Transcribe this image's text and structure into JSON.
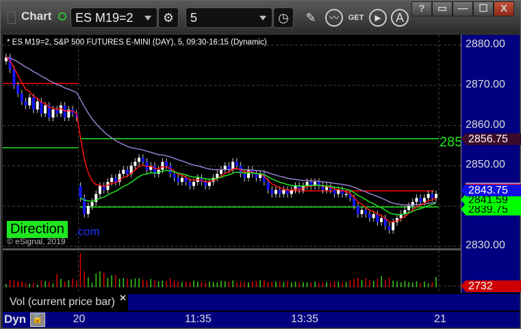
{
  "window": {
    "title": "Chart",
    "buttons": [
      "?",
      "▭",
      "—",
      "☐",
      "X"
    ]
  },
  "toolbar": {
    "symbol": "ES M19=2",
    "interval": "5"
  },
  "chart": {
    "info": "* ES M19=2, S&P 500 FUTURES E-MINI (DAY), 5, 09:30-16:15 (Dynamic)",
    "direction_label": "Direction",
    "link_fragment": ".com",
    "copyright": "© eSignal, 2019",
    "line_label": "285",
    "tags": [
      {
        "text": "2856.75",
        "bg": "#3c0a2a",
        "fg": "#ffffff"
      },
      {
        "text": "2843.75",
        "bg": "#1010e0",
        "fg": "#ffffff"
      },
      {
        "text": "2841.59",
        "bg": "#00ff00",
        "fg": "#000000"
      },
      {
        "text": "2839.75",
        "bg": "#00ff00",
        "fg": "#000000"
      }
    ],
    "volume_tag": "2732",
    "volume_study": "Vol (current price bar)",
    "close_symbol": "✕",
    "dyn": "Dyn"
  },
  "chart_data": {
    "type": "candlestick",
    "ylim": [
      2830,
      2880
    ],
    "yticks": [
      "2880.00",
      "2870.00",
      "2860.00",
      "2850.00",
      "2830.00"
    ],
    "xticks": [
      "20",
      "11:35",
      "13:35",
      "21"
    ],
    "closes": [
      2877,
      2874,
      2870,
      2868,
      2866,
      2865,
      2867,
      2864,
      2866,
      2863,
      2865,
      2862,
      2864,
      2863,
      2865,
      2862,
      2864,
      2863,
      2862,
      2842,
      2838,
      2840,
      2841,
      2843,
      2845,
      2844,
      2846,
      2847,
      2846,
      2848,
      2849,
      2848,
      2850,
      2851,
      2852,
      2851,
      2849,
      2850,
      2848,
      2849,
      2851,
      2850,
      2848,
      2847,
      2846,
      2847,
      2846,
      2845,
      2846,
      2847,
      2846,
      2845,
      2846,
      2847,
      2848,
      2849,
      2850,
      2849,
      2851,
      2850,
      2848,
      2847,
      2849,
      2848,
      2847,
      2848,
      2846,
      2844,
      2843,
      2844,
      2843,
      2844,
      2843,
      2844,
      2845,
      2844,
      2845,
      2846,
      2845,
      2846,
      2845,
      2844,
      2845,
      2844,
      2843,
      2844,
      2843,
      2843,
      2842,
      2840,
      2838,
      2839,
      2838,
      2837,
      2838,
      2836,
      2837,
      2835,
      2834,
      2836,
      2837,
      2838,
      2839,
      2840,
      2841,
      2842,
      2841,
      2842,
      2843,
      2842,
      2843
    ],
    "volume": [
      900,
      2000,
      1800,
      1600,
      1500,
      1100,
      900,
      1200,
      700,
      1800,
      1600,
      1500,
      1000,
      3500,
      2200,
      1500,
      1900,
      2300,
      1700,
      9000,
      4200,
      2600,
      1200,
      3600,
      4200,
      3800,
      2500,
      3200,
      3200,
      2200,
      2400,
      2300,
      2100,
      2300,
      2400,
      2000,
      1800,
      2200,
      1900,
      1600,
      1800,
      1700,
      2400,
      1700,
      1500,
      1300,
      1600,
      1400,
      1800,
      1500,
      1300,
      1200,
      1500,
      1400,
      1300,
      1700,
      1600,
      1500,
      1800,
      1200,
      1500,
      1400,
      1300,
      1600,
      1700,
      1900,
      2100,
      1300,
      1400,
      1500,
      1600,
      1400,
      1700,
      1300,
      1500,
      1200,
      1400,
      1300,
      1200,
      1500,
      1100,
      1300,
      1400,
      1200,
      1600,
      1500,
      1300,
      1400,
      1800,
      2200,
      2600,
      1900,
      2400,
      2000,
      1700,
      2200,
      2900,
      1900,
      2500,
      1800,
      1500,
      1300,
      1700,
      1400,
      1200,
      1600,
      1100,
      1500,
      1000,
      1300,
      2732
    ],
    "levels": [
      {
        "price": 2870.5,
        "color": "#ff0000",
        "day": 1
      },
      {
        "price": 2854.5,
        "color": "#1fe81f",
        "day": 1
      },
      {
        "price": 2856.75,
        "color": "#1fe81f",
        "day": 2
      },
      {
        "price": 2839.75,
        "color": "#1fe81f",
        "day": 2
      },
      {
        "price": 2843.75,
        "color": "#ff0000",
        "day": "2-late"
      }
    ],
    "day_break_index": 19
  }
}
